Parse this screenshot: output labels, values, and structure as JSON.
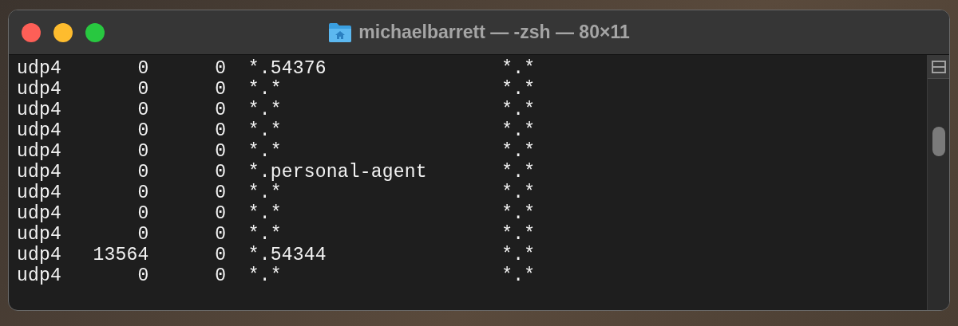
{
  "window": {
    "title": "michaelbarrett — -zsh — 80×11"
  },
  "terminal": {
    "rows": [
      {
        "proto": "udp4",
        "recv_q": "0",
        "send_q": "0",
        "local": "*.54376",
        "foreign": "*.*"
      },
      {
        "proto": "udp4",
        "recv_q": "0",
        "send_q": "0",
        "local": "*.*",
        "foreign": "*.*"
      },
      {
        "proto": "udp4",
        "recv_q": "0",
        "send_q": "0",
        "local": "*.*",
        "foreign": "*.*"
      },
      {
        "proto": "udp4",
        "recv_q": "0",
        "send_q": "0",
        "local": "*.*",
        "foreign": "*.*"
      },
      {
        "proto": "udp4",
        "recv_q": "0",
        "send_q": "0",
        "local": "*.*",
        "foreign": "*.*"
      },
      {
        "proto": "udp4",
        "recv_q": "0",
        "send_q": "0",
        "local": "*.personal-agent",
        "foreign": "*.*"
      },
      {
        "proto": "udp4",
        "recv_q": "0",
        "send_q": "0",
        "local": "*.*",
        "foreign": "*.*"
      },
      {
        "proto": "udp4",
        "recv_q": "0",
        "send_q": "0",
        "local": "*.*",
        "foreign": "*.*"
      },
      {
        "proto": "udp4",
        "recv_q": "0",
        "send_q": "0",
        "local": "*.*",
        "foreign": "*.*"
      },
      {
        "proto": "udp4",
        "recv_q": "13564",
        "send_q": "0",
        "local": "*.54344",
        "foreign": "*.*"
      },
      {
        "proto": "udp4",
        "recv_q": "0",
        "send_q": "0",
        "local": "*.*",
        "foreign": "*.*"
      }
    ]
  }
}
